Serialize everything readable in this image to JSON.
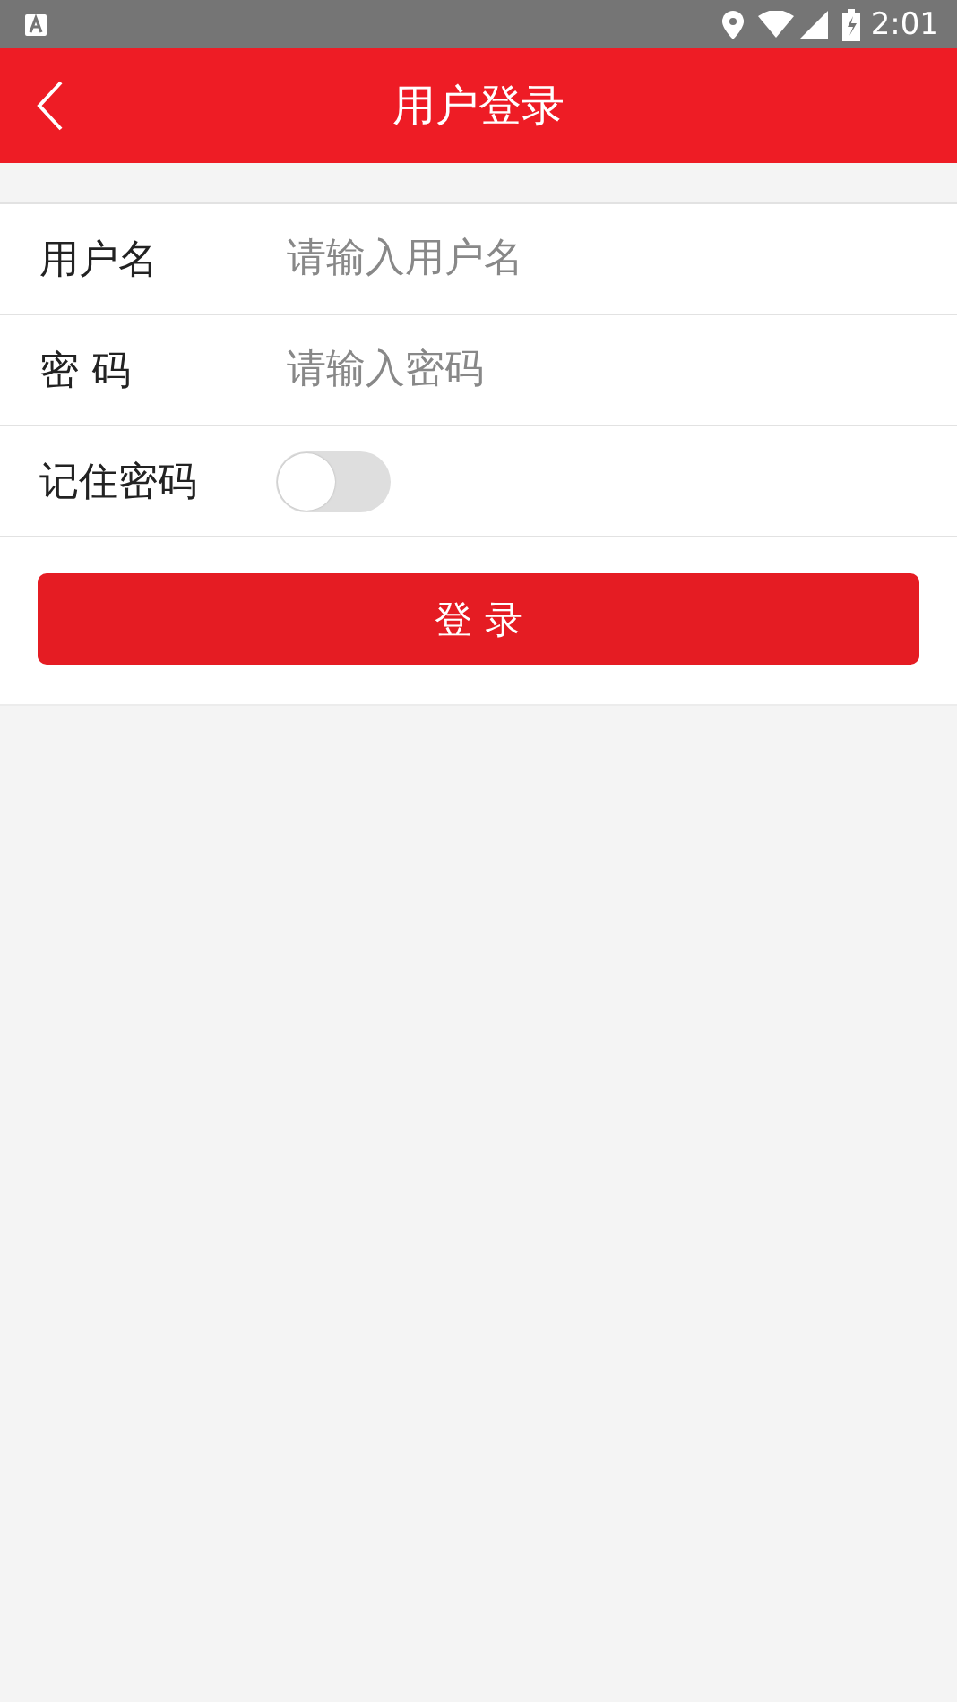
{
  "status_bar": {
    "time": "2:01"
  },
  "header": {
    "title": "用户登录"
  },
  "fields": [
    {
      "kind": "input",
      "label": "用户名",
      "placeholder": "请输入用户名"
    },
    {
      "kind": "input",
      "label": "密 码",
      "placeholder": "请输入密码"
    },
    {
      "kind": "toggle",
      "label": "记住密码",
      "on": false
    }
  ],
  "login_button": "登 录"
}
